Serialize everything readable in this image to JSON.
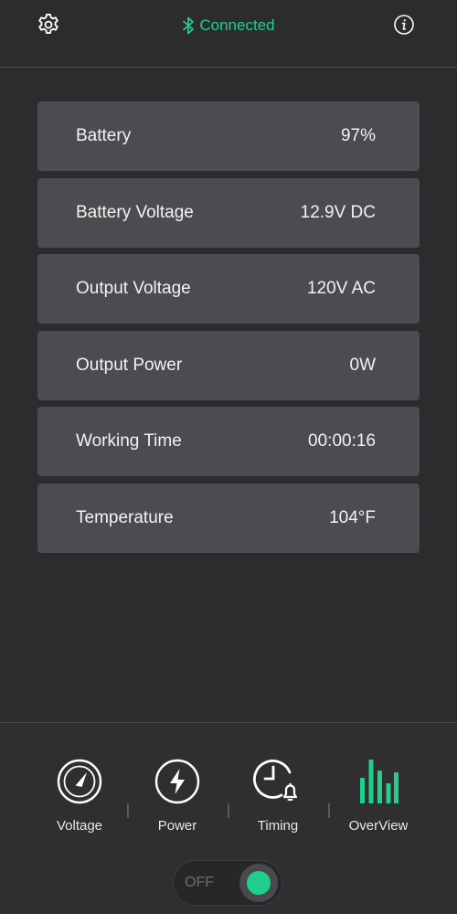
{
  "header": {
    "status_text": "Connected",
    "status_color": "#1fcf8c",
    "icons": [
      "gear-icon",
      "bluetooth-icon",
      "info-icon"
    ]
  },
  "rows": [
    {
      "label": "Battery",
      "value": "97%"
    },
    {
      "label": "Battery Voltage",
      "value": "12.9V DC"
    },
    {
      "label": "Output Voltage",
      "value": "120V AC"
    },
    {
      "label": "Output Power",
      "value": "0W"
    },
    {
      "label": "Working Time",
      "value": "00:00:16"
    },
    {
      "label": "Temperature",
      "value": "104°F"
    }
  ],
  "nav": {
    "items": [
      {
        "label": "Voltage",
        "icon": "gauge-icon"
      },
      {
        "label": "Power",
        "icon": "lightning-icon"
      },
      {
        "label": "Timing",
        "icon": "clock-bell-icon"
      },
      {
        "label": "OverView",
        "icon": "bar-chart-icon",
        "active": true
      }
    ],
    "active_color": "#1fcf8c"
  },
  "power_toggle": {
    "label": "OFF",
    "knob_color": "#1fcf8c"
  }
}
